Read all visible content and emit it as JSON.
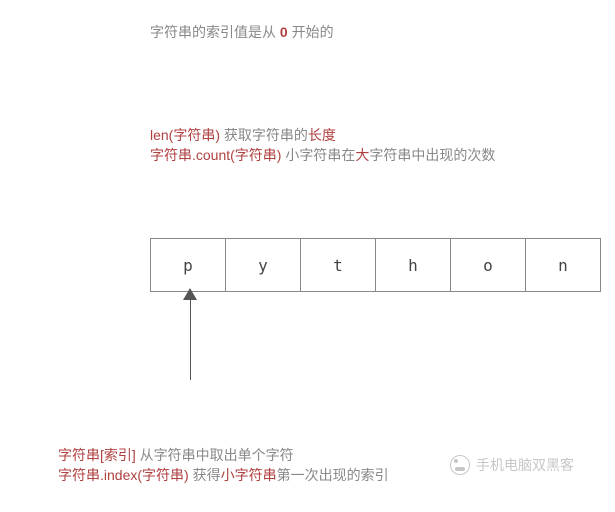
{
  "top_line": {
    "pre": "字符串的索引值是从 ",
    "bold": "0",
    "post": " 开始的"
  },
  "len_line": {
    "code": "len(字符串) ",
    "desc_pre": "获取字符串的",
    "desc_bold": "长度"
  },
  "count_line": {
    "code": "字符串.count(字符串) ",
    "desc_pre": "小字符串在",
    "desc_bold": "大",
    "desc_post": "字符串中出现的次数"
  },
  "cells": [
    "p",
    "y",
    "t",
    "h",
    "o",
    "n"
  ],
  "index_line": {
    "code": "字符串[索引] ",
    "desc": "从字符串中取出单个字符"
  },
  "indexof_line": {
    "code": "字符串.index(字符串) ",
    "desc_pre": "获得",
    "desc_bold": "小字符串",
    "desc_post": "第一次出现的索引"
  },
  "watermark": "手机电脑双黑客"
}
